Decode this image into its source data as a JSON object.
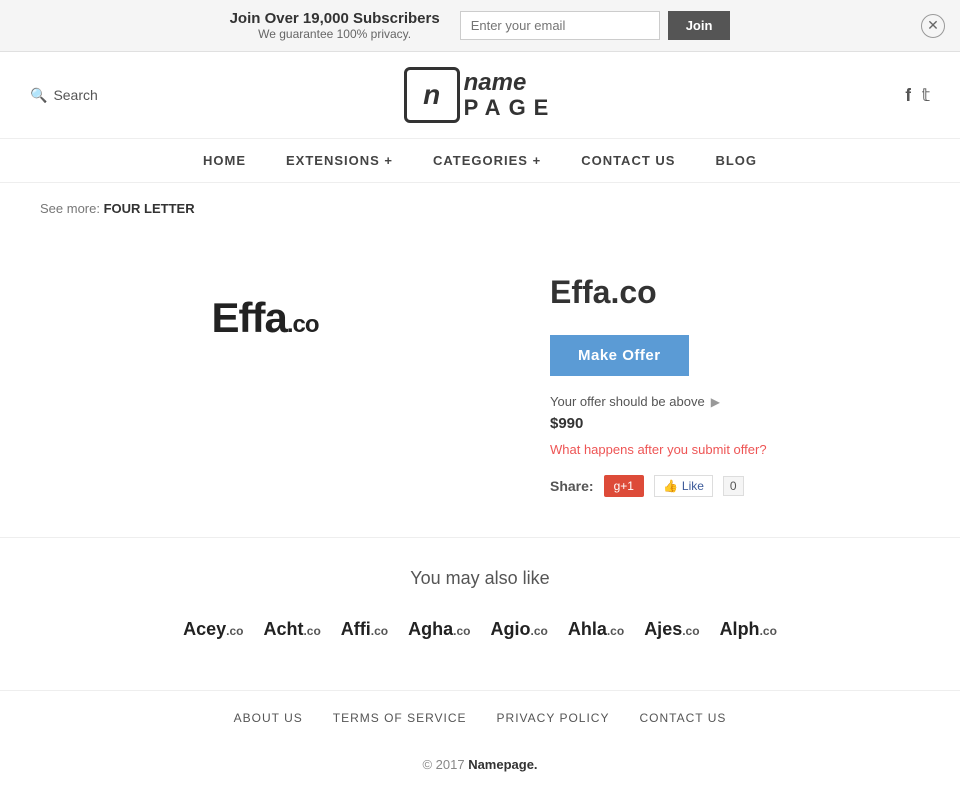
{
  "banner": {
    "main_text": "Join Over 19,000 Subscribers",
    "sub_text": "We guarantee 100% privacy.",
    "email_placeholder": "Enter your email",
    "join_label": "Join"
  },
  "header": {
    "search_label": "Search",
    "logo_icon": "n",
    "logo_name": "name",
    "logo_page": "PAGE",
    "facebook_icon": "f",
    "twitter_icon": "t"
  },
  "nav": {
    "items": [
      {
        "label": "HOME",
        "id": "home"
      },
      {
        "label": "EXTENSIONS +",
        "id": "extensions"
      },
      {
        "label": "CATEGORIES +",
        "id": "categories"
      },
      {
        "label": "CONTACT US",
        "id": "contact"
      },
      {
        "label": "BLOG",
        "id": "blog"
      }
    ]
  },
  "breadcrumb": {
    "see_more": "See more:",
    "link_text": "FOUR LETTER"
  },
  "domain": {
    "name": "Effa",
    "tld": ".co",
    "full": "Effa.co",
    "make_offer_label": "Make Offer",
    "offer_info": "Your offer should be above",
    "price": "$990",
    "what_happens": "What happens after you submit offer?",
    "share_label": "Share:",
    "gplus_label": "g+1",
    "fb_like_label": "Like",
    "fb_count": "0"
  },
  "also_like": {
    "title": "You may also like",
    "items": [
      {
        "name": "Acey",
        "tld": ".co"
      },
      {
        "name": "Acht",
        "tld": ".co"
      },
      {
        "name": "Affi",
        "tld": ".co"
      },
      {
        "name": "Agha",
        "tld": ".co"
      },
      {
        "name": "Agio",
        "tld": ".co"
      },
      {
        "name": "Ahla",
        "tld": ".co"
      },
      {
        "name": "Ajes",
        "tld": ".co"
      },
      {
        "name": "Alph",
        "tld": ".co"
      }
    ]
  },
  "footer": {
    "links": [
      {
        "label": "ABOUT US",
        "id": "about"
      },
      {
        "label": "TERMS OF SERVICE",
        "id": "terms"
      },
      {
        "label": "PRIVACY POLICY",
        "id": "privacy"
      },
      {
        "label": "CONTACT US",
        "id": "contact"
      }
    ],
    "copy": "© 2017",
    "brand": "Namepage."
  }
}
